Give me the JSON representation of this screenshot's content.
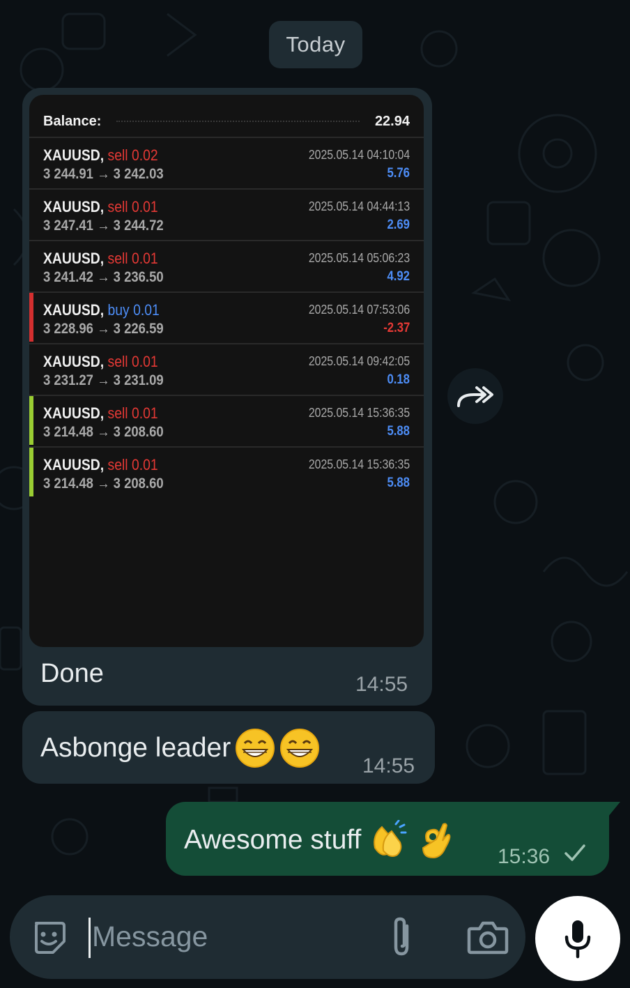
{
  "date_chip": "Today",
  "screenshot": {
    "balance_label": "Balance:",
    "balance_value": "22.94",
    "trades": [
      {
        "symbol": "XAUUSD,",
        "side": "sell 0.02",
        "side_color": "#e53935",
        "prices": "3 244.91 → 3 242.03",
        "datetime": "2025.05.14 04:10:04",
        "profit": "5.76",
        "profit_color": "#4d8df6",
        "marker_color": ""
      },
      {
        "symbol": "XAUUSD,",
        "side": "sell 0.01",
        "side_color": "#e53935",
        "prices": "3 247.41 → 3 244.72",
        "datetime": "2025.05.14 04:44:13",
        "profit": "2.69",
        "profit_color": "#4d8df6",
        "marker_color": ""
      },
      {
        "symbol": "XAUUSD,",
        "side": "sell 0.01",
        "side_color": "#e53935",
        "prices": "3 241.42 → 3 236.50",
        "datetime": "2025.05.14 05:06:23",
        "profit": "4.92",
        "profit_color": "#4d8df6",
        "marker_color": ""
      },
      {
        "symbol": "XAUUSD,",
        "side": "buy 0.01",
        "side_color": "#4d8df6",
        "prices": "3 228.96 → 3 226.59",
        "datetime": "2025.05.14 07:53:06",
        "profit": "-2.37",
        "profit_color": "#e53935",
        "marker_color": "#d32f2f"
      },
      {
        "symbol": "XAUUSD,",
        "side": "sell 0.01",
        "side_color": "#e53935",
        "prices": "3 231.27 → 3 231.09",
        "datetime": "2025.05.14 09:42:05",
        "profit": "0.18",
        "profit_color": "#4d8df6",
        "marker_color": ""
      },
      {
        "symbol": "XAUUSD,",
        "side": "sell 0.01",
        "side_color": "#e53935",
        "prices": "3 214.48 → 3 208.60",
        "datetime": "2025.05.14 15:36:35",
        "profit": "5.88",
        "profit_color": "#4d8df6",
        "marker_color": "#9acd32"
      },
      {
        "symbol": "XAUUSD,",
        "side": "sell 0.01",
        "side_color": "#e53935",
        "prices": "3 214.48 → 3 208.60",
        "datetime": "2025.05.14 15:36:35",
        "profit": "5.88",
        "profit_color": "#4d8df6",
        "marker_color": "#9acd32"
      }
    ]
  },
  "messages": {
    "img_caption": "Done",
    "img_time": "14:55",
    "msg2_text": "Asbonge leader",
    "msg2_emoji": "grinning-face-emoji x2",
    "msg2_time": "14:55",
    "out_text": "Awesome stuff",
    "out_emoji": "clapping-hands-emoji, ok-hand-emoji",
    "out_time": "15:36"
  },
  "composer": {
    "placeholder": "Message",
    "icons": [
      "sticker-icon",
      "attach-icon",
      "camera-icon",
      "mic-icon"
    ]
  },
  "colors": {
    "background": "#0b1014",
    "incoming_bubble": "#1f2c33",
    "outgoing_bubble": "#144d37"
  }
}
